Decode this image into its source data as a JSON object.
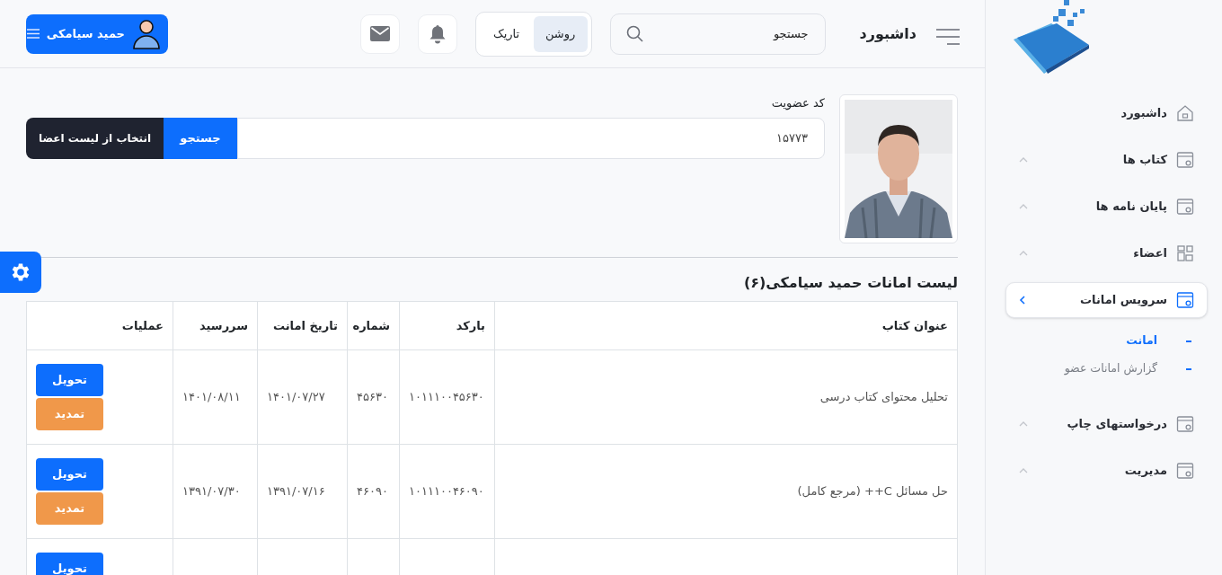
{
  "sidebar": {
    "items": [
      {
        "label": "داشبورد",
        "kind": "home",
        "selected": false
      },
      {
        "label": "کتاب ها",
        "kind": "window",
        "selected": false,
        "expanded": false
      },
      {
        "label": "پایان نامه ها",
        "kind": "window",
        "selected": false,
        "expanded": false
      },
      {
        "label": "اعضاء",
        "kind": "grid",
        "selected": false,
        "expanded": false
      },
      {
        "label": "سرویس امانات",
        "kind": "window",
        "selected": true,
        "expanded": true,
        "children": [
          {
            "label": "امانت",
            "selected": true
          },
          {
            "label": "گزارش امانات عضو",
            "selected": false
          }
        ]
      },
      {
        "label": "درخواستهای چاپ",
        "kind": "window",
        "selected": false,
        "expanded": false
      },
      {
        "label": "مدیریت",
        "kind": "window",
        "selected": false,
        "expanded": false
      }
    ]
  },
  "header": {
    "title": "داشبورد",
    "search": {
      "placeholder": "جستجو"
    },
    "theme_toggle": [
      {
        "label": "روشن",
        "selected": true
      },
      {
        "label": "تاریک",
        "selected": false
      }
    ],
    "user": {
      "name": "حمید سیامکی"
    }
  },
  "member": {
    "label": "کد عضویت",
    "value": "۱۵۷۷۳",
    "search_button": "جستجو",
    "pick_button": "انتخاب از لیست اعضا"
  },
  "loans": {
    "title": "لیست امانات حمید سیامکی(۶)",
    "columns": [
      "عنوان کتاب",
      "بارکد",
      "شماره",
      "تاریخ امانت",
      "سررسید",
      "عملیات"
    ],
    "rows": [
      {
        "title": "تحلیل محتوای کتاب درسی",
        "barcode": "۱۰۱۱۱۰۰۴۵۶۳۰",
        "number": "۴۵۶۳۰",
        "loan_date": "۱۴۰۱/۰۷/۲۷",
        "due_date": "۱۴۰۱/۰۸/۱۱",
        "actions": [
          {
            "label": "تحویل",
            "kind": "return"
          },
          {
            "label": "تمدید",
            "kind": "renew"
          }
        ]
      },
      {
        "title": "حل مسائل C++ (مرجع کامل)",
        "barcode": "۱۰۱۱۱۰۰۴۶۰۹۰",
        "number": "۴۶۰۹۰",
        "loan_date": "۱۳۹۱/۰۷/۱۶",
        "due_date": "۱۳۹۱/۰۷/۳۰",
        "actions": [
          {
            "label": "تحویل",
            "kind": "return"
          },
          {
            "label": "تمدید",
            "kind": "renew"
          }
        ]
      },
      {
        "actions": [
          {
            "label": "تحویل",
            "kind": "return"
          }
        ]
      }
    ]
  }
}
